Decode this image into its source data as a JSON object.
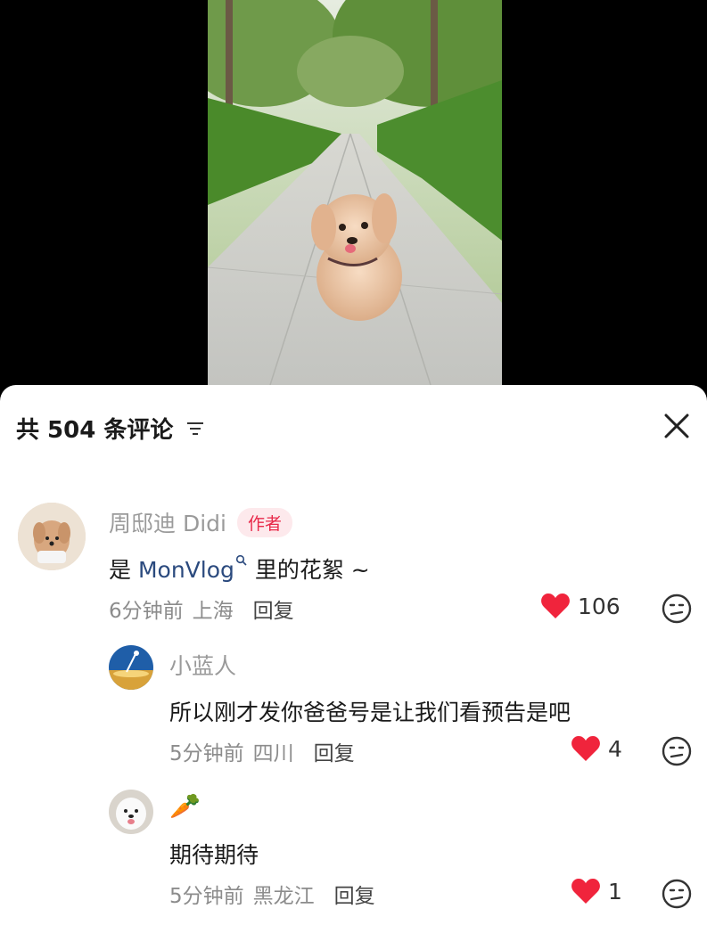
{
  "header": {
    "comment_count_label": "共 504 条评论",
    "sort_icon": "filter-sort-icon",
    "close_icon": "close-icon"
  },
  "comments": [
    {
      "author": "周邸迪 Didi",
      "badge": "作者",
      "text_prefix": "是 ",
      "mention": "MonVlog",
      "text_suffix": " 里的花絮 ~",
      "time": "6分钟前",
      "location": "上海",
      "reply_label": "回复",
      "likes": "106"
    },
    {
      "author": "小蓝人",
      "text": "所以刚才发你爸爸号是让我们看预告是吧",
      "time": "5分钟前",
      "location": "四川",
      "reply_label": "回复",
      "likes": "4"
    },
    {
      "author": "🥕",
      "text": "期待期待",
      "time": "5分钟前",
      "location": "黑龙江",
      "reply_label": "回复",
      "likes": "1"
    }
  ],
  "colors": {
    "like_red": "#f0243c",
    "badge_red": "#e8294a",
    "mention_blue": "#2b4a7e"
  }
}
